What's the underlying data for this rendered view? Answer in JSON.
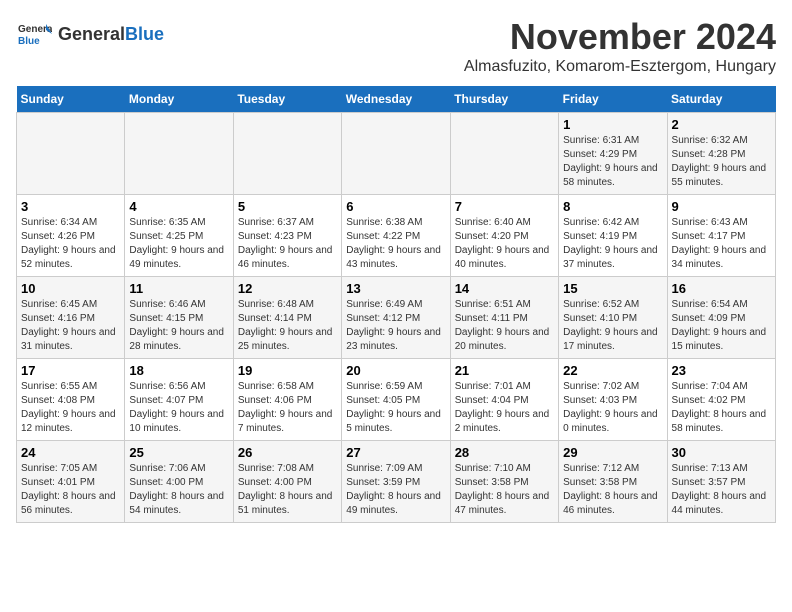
{
  "logo": {
    "general": "General",
    "blue": "Blue"
  },
  "title": {
    "month": "November 2024",
    "location": "Almasfuzito, Komarom-Esztergom, Hungary"
  },
  "headers": [
    "Sunday",
    "Monday",
    "Tuesday",
    "Wednesday",
    "Thursday",
    "Friday",
    "Saturday"
  ],
  "weeks": [
    [
      {
        "day": "",
        "info": ""
      },
      {
        "day": "",
        "info": ""
      },
      {
        "day": "",
        "info": ""
      },
      {
        "day": "",
        "info": ""
      },
      {
        "day": "",
        "info": ""
      },
      {
        "day": "1",
        "info": "Sunrise: 6:31 AM\nSunset: 4:29 PM\nDaylight: 9 hours and 58 minutes."
      },
      {
        "day": "2",
        "info": "Sunrise: 6:32 AM\nSunset: 4:28 PM\nDaylight: 9 hours and 55 minutes."
      }
    ],
    [
      {
        "day": "3",
        "info": "Sunrise: 6:34 AM\nSunset: 4:26 PM\nDaylight: 9 hours and 52 minutes."
      },
      {
        "day": "4",
        "info": "Sunrise: 6:35 AM\nSunset: 4:25 PM\nDaylight: 9 hours and 49 minutes."
      },
      {
        "day": "5",
        "info": "Sunrise: 6:37 AM\nSunset: 4:23 PM\nDaylight: 9 hours and 46 minutes."
      },
      {
        "day": "6",
        "info": "Sunrise: 6:38 AM\nSunset: 4:22 PM\nDaylight: 9 hours and 43 minutes."
      },
      {
        "day": "7",
        "info": "Sunrise: 6:40 AM\nSunset: 4:20 PM\nDaylight: 9 hours and 40 minutes."
      },
      {
        "day": "8",
        "info": "Sunrise: 6:42 AM\nSunset: 4:19 PM\nDaylight: 9 hours and 37 minutes."
      },
      {
        "day": "9",
        "info": "Sunrise: 6:43 AM\nSunset: 4:17 PM\nDaylight: 9 hours and 34 minutes."
      }
    ],
    [
      {
        "day": "10",
        "info": "Sunrise: 6:45 AM\nSunset: 4:16 PM\nDaylight: 9 hours and 31 minutes."
      },
      {
        "day": "11",
        "info": "Sunrise: 6:46 AM\nSunset: 4:15 PM\nDaylight: 9 hours and 28 minutes."
      },
      {
        "day": "12",
        "info": "Sunrise: 6:48 AM\nSunset: 4:14 PM\nDaylight: 9 hours and 25 minutes."
      },
      {
        "day": "13",
        "info": "Sunrise: 6:49 AM\nSunset: 4:12 PM\nDaylight: 9 hours and 23 minutes."
      },
      {
        "day": "14",
        "info": "Sunrise: 6:51 AM\nSunset: 4:11 PM\nDaylight: 9 hours and 20 minutes."
      },
      {
        "day": "15",
        "info": "Sunrise: 6:52 AM\nSunset: 4:10 PM\nDaylight: 9 hours and 17 minutes."
      },
      {
        "day": "16",
        "info": "Sunrise: 6:54 AM\nSunset: 4:09 PM\nDaylight: 9 hours and 15 minutes."
      }
    ],
    [
      {
        "day": "17",
        "info": "Sunrise: 6:55 AM\nSunset: 4:08 PM\nDaylight: 9 hours and 12 minutes."
      },
      {
        "day": "18",
        "info": "Sunrise: 6:56 AM\nSunset: 4:07 PM\nDaylight: 9 hours and 10 minutes."
      },
      {
        "day": "19",
        "info": "Sunrise: 6:58 AM\nSunset: 4:06 PM\nDaylight: 9 hours and 7 minutes."
      },
      {
        "day": "20",
        "info": "Sunrise: 6:59 AM\nSunset: 4:05 PM\nDaylight: 9 hours and 5 minutes."
      },
      {
        "day": "21",
        "info": "Sunrise: 7:01 AM\nSunset: 4:04 PM\nDaylight: 9 hours and 2 minutes."
      },
      {
        "day": "22",
        "info": "Sunrise: 7:02 AM\nSunset: 4:03 PM\nDaylight: 9 hours and 0 minutes."
      },
      {
        "day": "23",
        "info": "Sunrise: 7:04 AM\nSunset: 4:02 PM\nDaylight: 8 hours and 58 minutes."
      }
    ],
    [
      {
        "day": "24",
        "info": "Sunrise: 7:05 AM\nSunset: 4:01 PM\nDaylight: 8 hours and 56 minutes."
      },
      {
        "day": "25",
        "info": "Sunrise: 7:06 AM\nSunset: 4:00 PM\nDaylight: 8 hours and 54 minutes."
      },
      {
        "day": "26",
        "info": "Sunrise: 7:08 AM\nSunset: 4:00 PM\nDaylight: 8 hours and 51 minutes."
      },
      {
        "day": "27",
        "info": "Sunrise: 7:09 AM\nSunset: 3:59 PM\nDaylight: 8 hours and 49 minutes."
      },
      {
        "day": "28",
        "info": "Sunrise: 7:10 AM\nSunset: 3:58 PM\nDaylight: 8 hours and 47 minutes."
      },
      {
        "day": "29",
        "info": "Sunrise: 7:12 AM\nSunset: 3:58 PM\nDaylight: 8 hours and 46 minutes."
      },
      {
        "day": "30",
        "info": "Sunrise: 7:13 AM\nSunset: 3:57 PM\nDaylight: 8 hours and 44 minutes."
      }
    ]
  ]
}
